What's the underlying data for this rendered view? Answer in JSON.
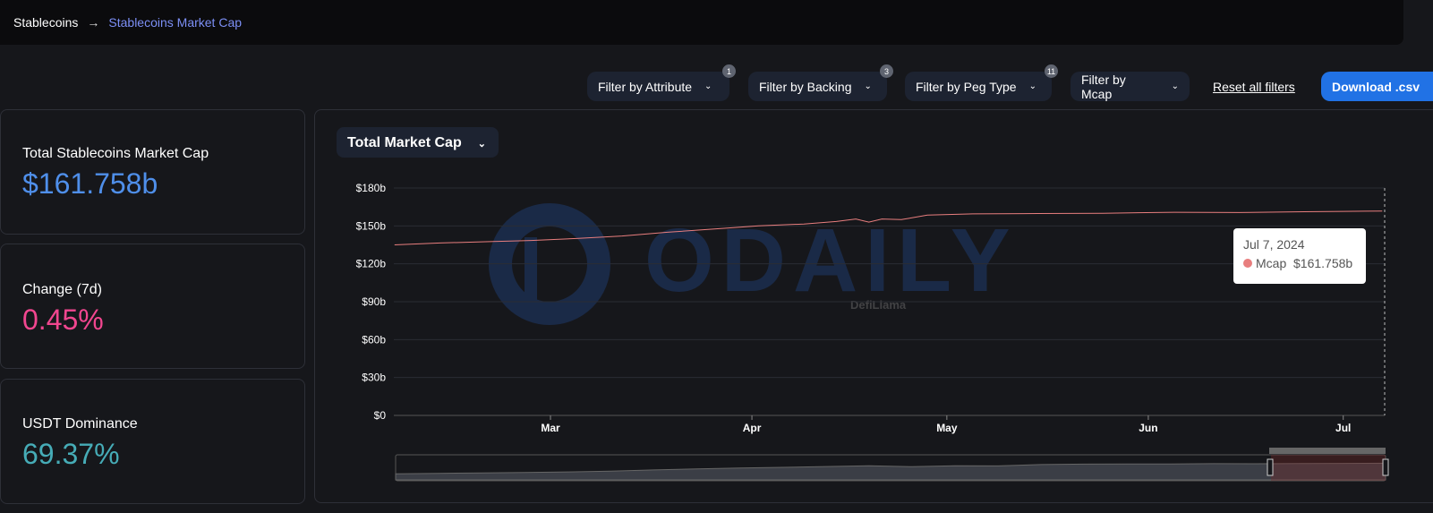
{
  "breadcrumb": {
    "root": "Stablecoins",
    "current": "Stablecoins Market Cap"
  },
  "filters": [
    {
      "label": "Filter by Attribute",
      "badge": "1"
    },
    {
      "label": "Filter by Backing",
      "badge": "3"
    },
    {
      "label": "Filter by Peg Type",
      "badge": "11"
    },
    {
      "label": "Filter by Mcap",
      "badge": null
    }
  ],
  "reset_label": "Reset all filters",
  "download_label": "Download .csv",
  "stats": [
    {
      "label": "Total Stablecoins Market Cap",
      "value": "$161.758b",
      "color": "#4f8fea"
    },
    {
      "label": "Change (7d)",
      "value": "0.45%",
      "color": "#f1468f"
    },
    {
      "label": "USDT Dominance",
      "value": "69.37%",
      "color": "#46acb7"
    }
  ],
  "chart_selector": "Total Market Cap",
  "watermark": {
    "brand": "ODAILY",
    "source": "DefiLlama"
  },
  "tooltip": {
    "date": "Jul 7, 2024",
    "series": "Mcap",
    "value": "$161.758b"
  },
  "chart_data": {
    "type": "line",
    "series": [
      {
        "name": "Mcap",
        "color": "#e87e7e",
        "x": [
          "2024-02-06",
          "2024-02-13",
          "2024-02-20",
          "2024-02-27",
          "2024-03-05",
          "2024-03-12",
          "2024-03-19",
          "2024-03-26",
          "2024-04-02",
          "2024-04-09",
          "2024-04-14",
          "2024-04-17",
          "2024-04-19",
          "2024-04-21",
          "2024-04-24",
          "2024-04-28",
          "2024-05-05",
          "2024-05-15",
          "2024-05-25",
          "2024-06-05",
          "2024-06-15",
          "2024-06-25",
          "2024-07-01",
          "2024-07-07"
        ],
        "y": [
          135,
          136.5,
          137.5,
          138.5,
          140,
          142,
          145,
          147.5,
          150,
          151.5,
          153.5,
          155.5,
          153,
          155.5,
          155,
          158.5,
          159.5,
          159.8,
          160,
          160.8,
          160.6,
          161.2,
          161.5,
          161.758
        ]
      }
    ],
    "ylim": [
      0,
      180
    ],
    "yticks": [
      "$0",
      "$30b",
      "$60b",
      "$90b",
      "$120b",
      "$150b",
      "$180b"
    ],
    "xticks": [
      "Mar",
      "Apr",
      "May",
      "Jun",
      "Jul"
    ],
    "grid": true
  }
}
